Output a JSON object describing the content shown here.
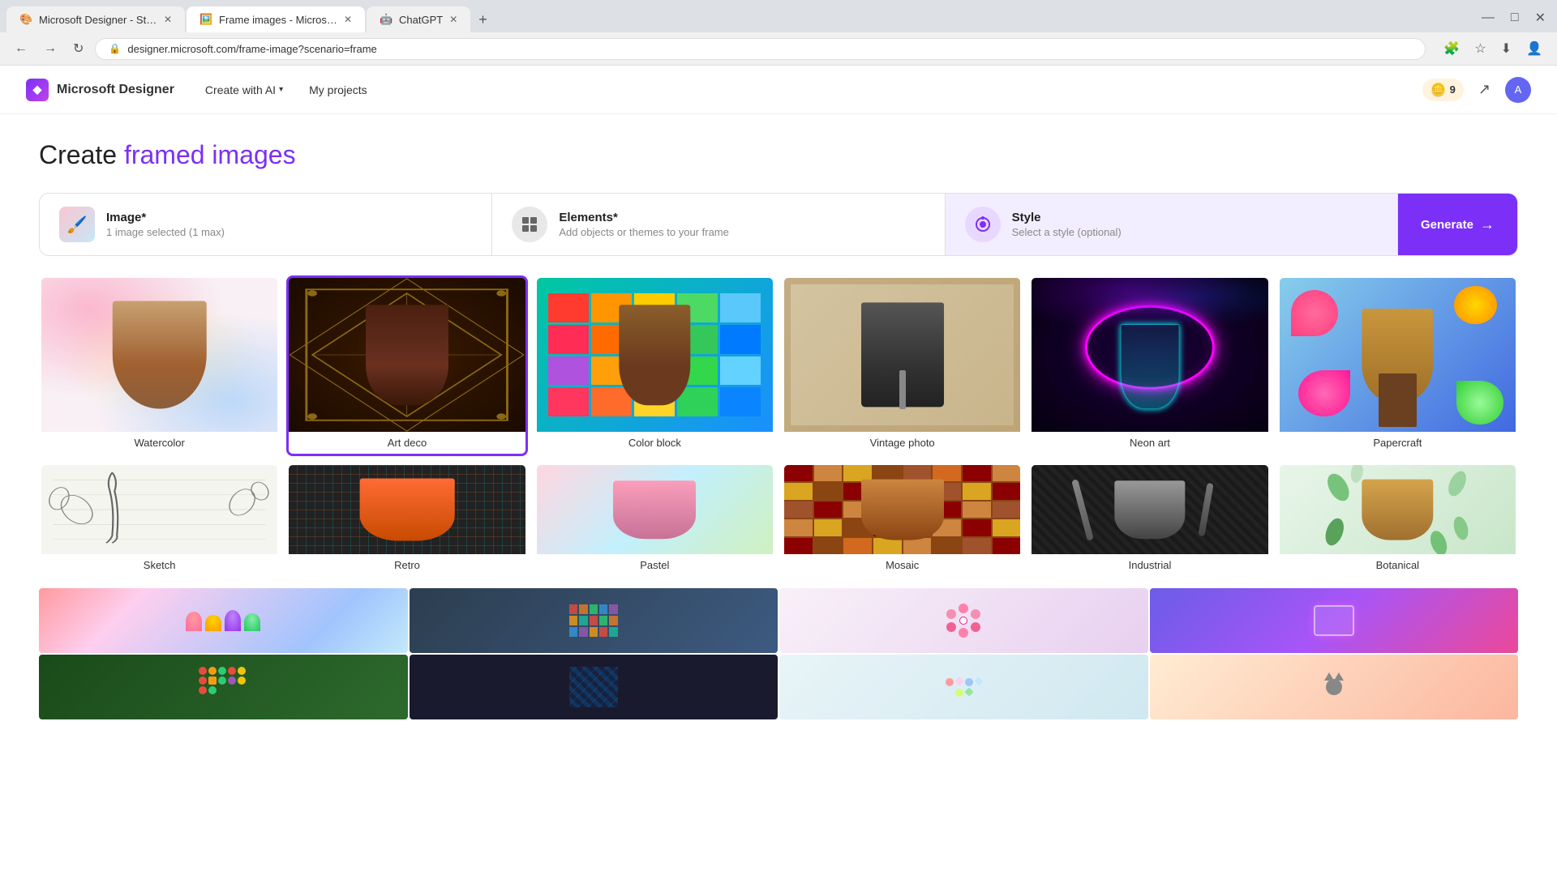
{
  "browser": {
    "tabs": [
      {
        "id": "tab1",
        "title": "Microsoft Designer - Stunning",
        "active": false,
        "favicon": "🎨"
      },
      {
        "id": "tab2",
        "title": "Frame images - Microsoft Des...",
        "active": true,
        "favicon": "🖼️"
      },
      {
        "id": "tab3",
        "title": "ChatGPT",
        "active": false,
        "favicon": "🤖"
      }
    ],
    "address": "designer.microsoft.com/frame-image?scenario=frame"
  },
  "app": {
    "logo_text": "◆",
    "name": "Microsoft Designer",
    "nav": [
      {
        "label": "Create with AI",
        "has_dropdown": true
      },
      {
        "label": "My projects",
        "has_dropdown": false
      }
    ],
    "coins": "9",
    "avatar_initial": "A"
  },
  "page": {
    "title_prefix": "Create ",
    "title_highlight": "framed images"
  },
  "steps": [
    {
      "label": "Image*",
      "sublabel": "1 image selected (1 max)",
      "has_preview": true
    },
    {
      "label": "Elements*",
      "sublabel": "Add objects or themes to your frame",
      "has_preview": false
    },
    {
      "label": "Style",
      "sublabel": "Select a style (optional)",
      "has_preview": false,
      "active": true
    }
  ],
  "generate_btn": "Generate",
  "styles": [
    {
      "id": "watercolor",
      "label": "Watercolor",
      "selected": false
    },
    {
      "id": "artdeco",
      "label": "Art deco",
      "selected": true
    },
    {
      "id": "colorblock",
      "label": "Color block",
      "selected": false
    },
    {
      "id": "vintage",
      "label": "Vintage photo",
      "selected": false
    },
    {
      "id": "neon",
      "label": "Neon art",
      "selected": false
    },
    {
      "id": "papercraft",
      "label": "Papercraft",
      "selected": false
    },
    {
      "id": "sketch",
      "label": "Sketch",
      "selected": false
    },
    {
      "id": "retro",
      "label": "Retro",
      "selected": false
    },
    {
      "id": "pastel",
      "label": "Pastel",
      "selected": false
    },
    {
      "id": "mosaic",
      "label": "Mosaic",
      "selected": false
    },
    {
      "id": "industrial",
      "label": "Industrial",
      "selected": false
    },
    {
      "id": "botanical",
      "label": "Botanical",
      "selected": false
    }
  ],
  "bottom_strip": [
    {
      "id": "bs1",
      "class": "bt1"
    },
    {
      "id": "bs2",
      "class": "bt2"
    },
    {
      "id": "bs3",
      "class": "bt3"
    },
    {
      "id": "bs4",
      "class": "bt4"
    }
  ],
  "bottom_strip2": [
    {
      "id": "bs5",
      "class": "bt5"
    },
    {
      "id": "bs6",
      "class": "bt6"
    },
    {
      "id": "bs7",
      "class": "bt7"
    },
    {
      "id": "bs8",
      "class": "bt8"
    }
  ]
}
